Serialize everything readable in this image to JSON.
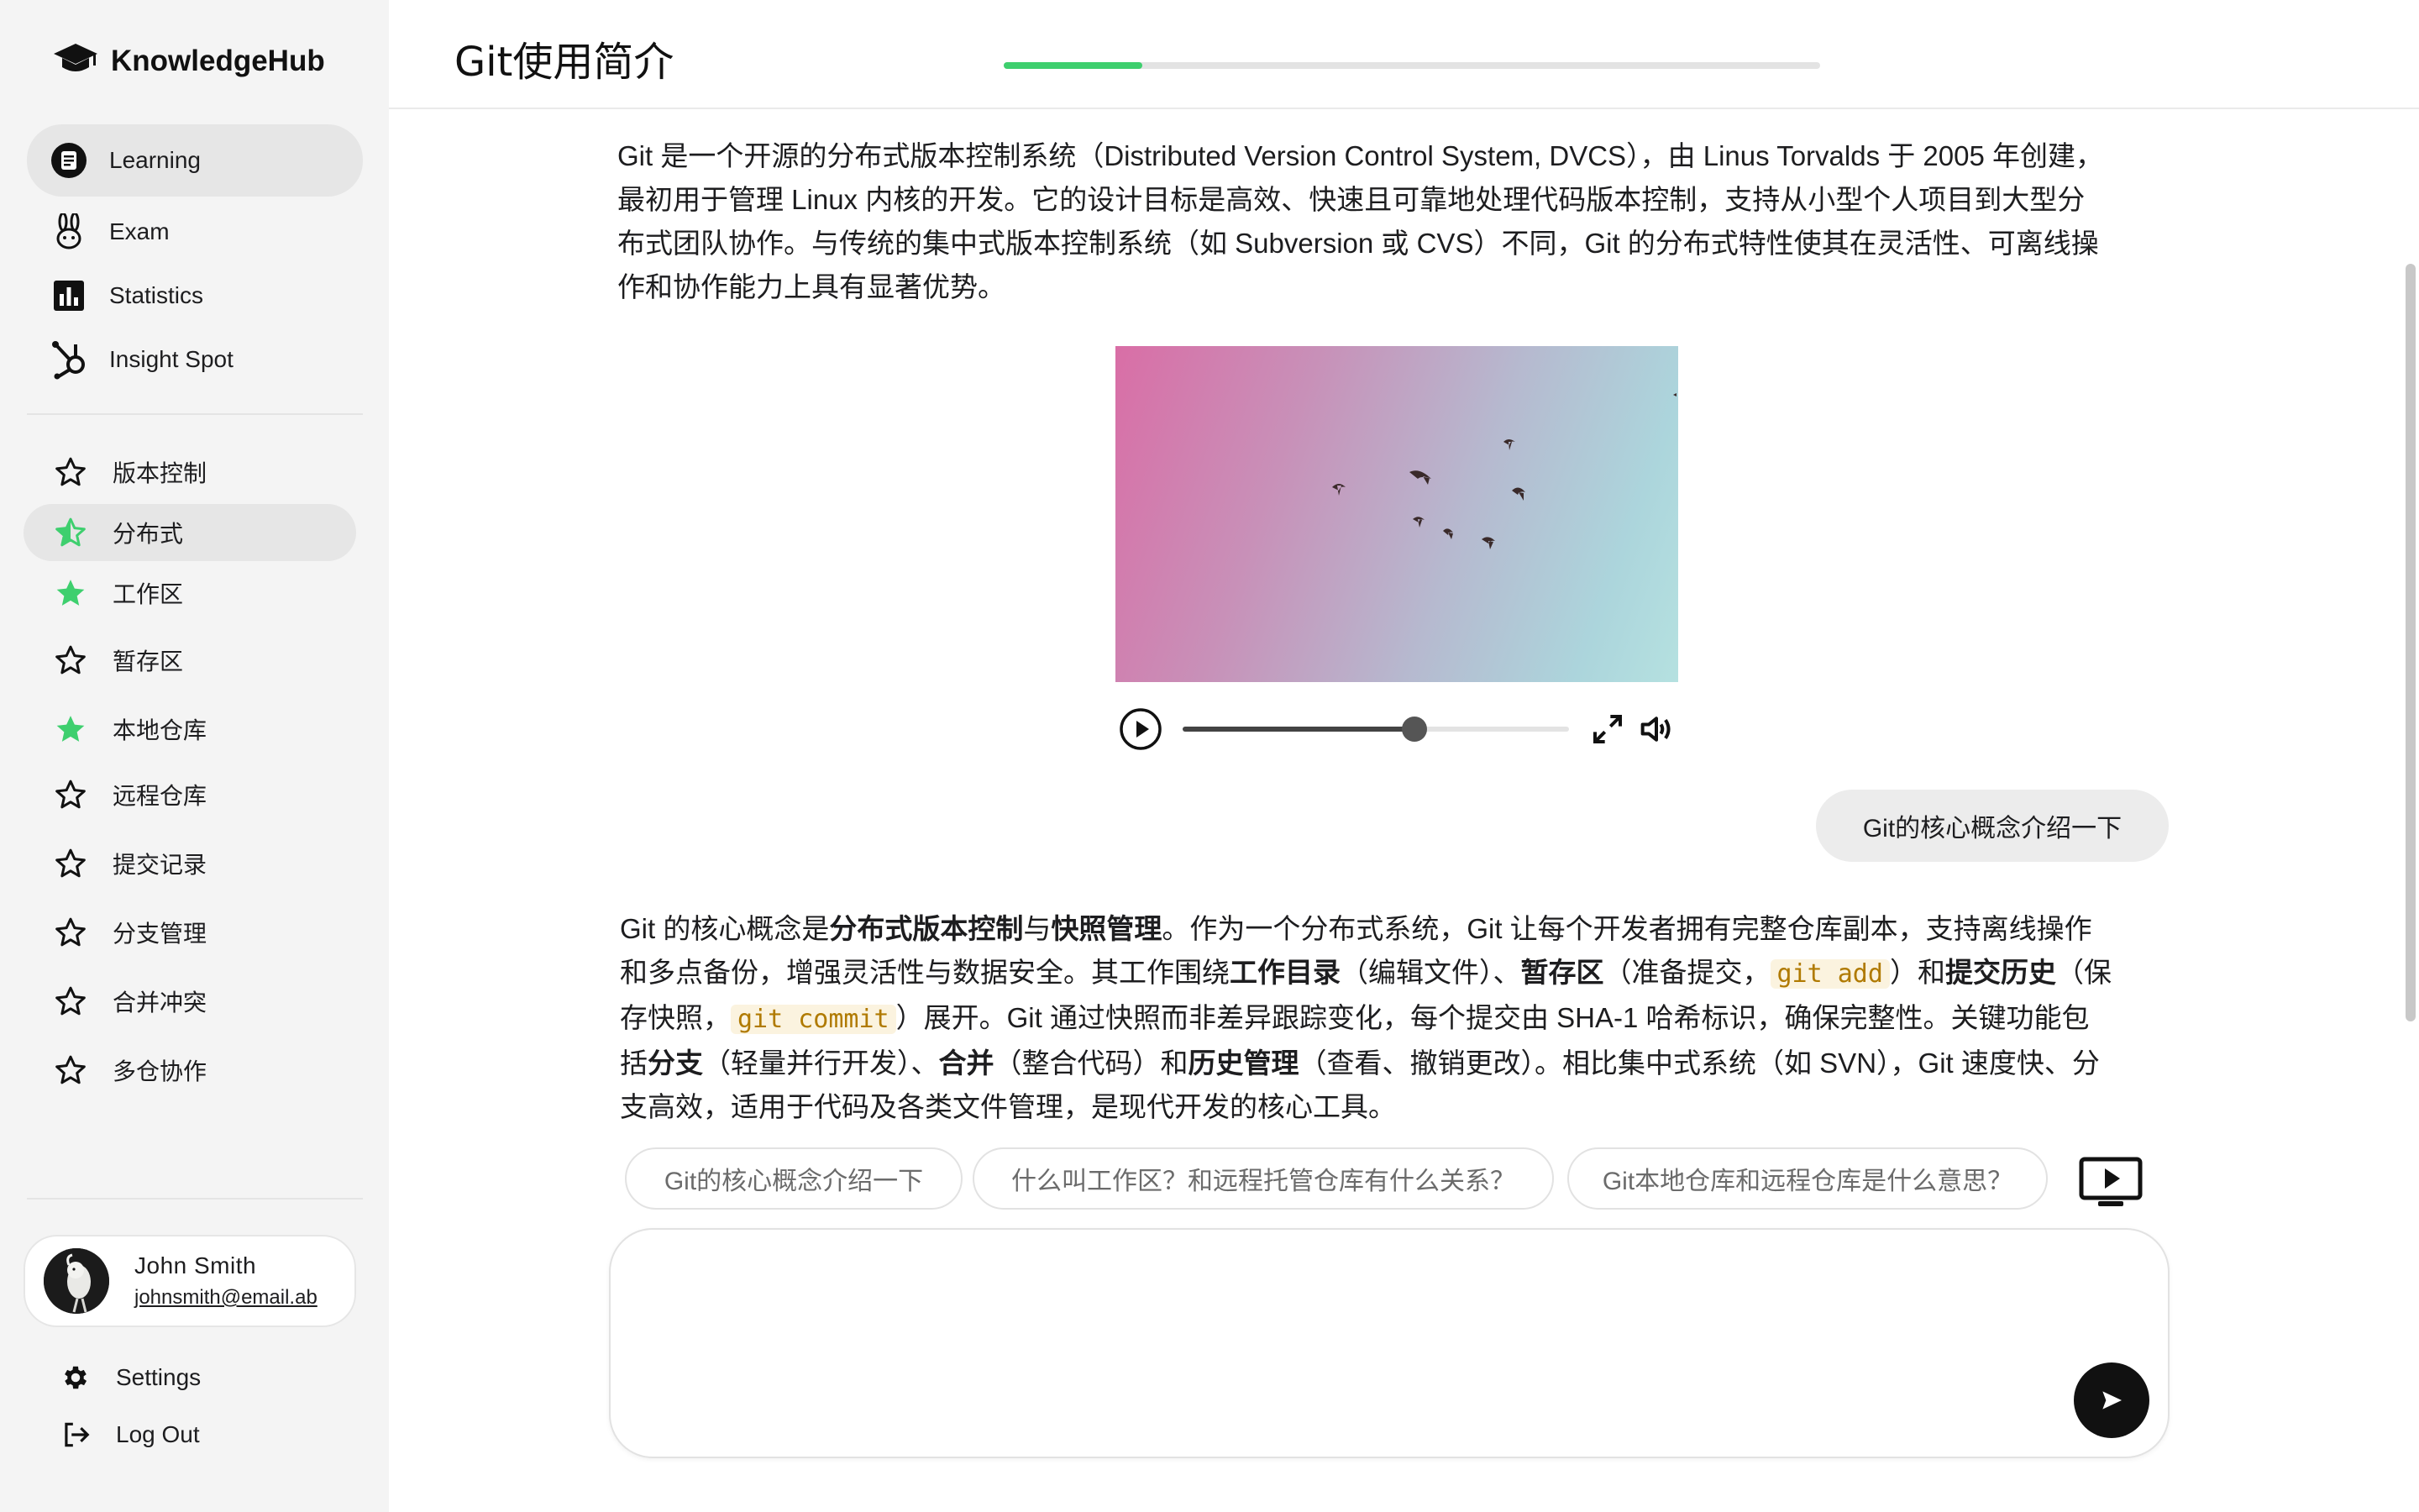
{
  "app": {
    "name": "KnowledgeHub"
  },
  "nav": {
    "items": [
      {
        "label": "Learning",
        "icon": "notebook-icon",
        "active": true
      },
      {
        "label": "Exam",
        "icon": "rabbit-icon",
        "active": false
      },
      {
        "label": "Statistics",
        "icon": "bar-chart-icon",
        "active": false
      },
      {
        "label": "Insight Spot",
        "icon": "hub-icon",
        "active": false
      }
    ]
  },
  "topics": [
    {
      "label": "版本控制",
      "state": "empty"
    },
    {
      "label": "分布式",
      "state": "half",
      "active": true
    },
    {
      "label": "工作区",
      "state": "full"
    },
    {
      "label": "暂存区",
      "state": "empty"
    },
    {
      "label": "本地仓库",
      "state": "full"
    },
    {
      "label": "远程仓库",
      "state": "empty"
    },
    {
      "label": "提交记录",
      "state": "empty"
    },
    {
      "label": "分支管理",
      "state": "empty"
    },
    {
      "label": "合并冲突",
      "state": "empty"
    },
    {
      "label": "多仓协作",
      "state": "empty"
    }
  ],
  "user": {
    "name": "John Smith",
    "email": "johnsmith@email.ab"
  },
  "footer": {
    "settings": "Settings",
    "logout": "Log Out"
  },
  "header": {
    "title": "Git使用简介",
    "progress": 0.17
  },
  "content": {
    "intro": "Git 是一个开源的分布式版本控制系统（Distributed Version Control System, DVCS），由 Linus Torvalds 于 2005 年创建，最初用于管理 Linux 内核的开发。它的设计目标是高效、快速且可靠地处理代码版本控制，支持从小型个人项目到大型分布式团队协作。与传统的集中式版本控制系统（如 Subversion 或 CVS）不同，Git 的分布式特性使其在灵活性、可离线操作和协作能力上具有显著优势。",
    "video": {
      "seek_progress": 0.6
    },
    "user_question": "Git的核心概念介绍一下",
    "answer": {
      "p1": "Git 的核心概念是",
      "b1": "分布式版本控制",
      "p2": "与",
      "b2": "快照管理",
      "p3": "。作为一个分布式系统，Git 让每个开发者拥有完整仓库副本，支持离线操作和多点备份，增强灵活性与数据安全。其工作围绕",
      "b3": "工作目录",
      "p4": "（编辑文件）、",
      "b4": "暂存区",
      "p5": "（准备提交，",
      "c1": "git add",
      "p6": "）和",
      "b5": "提交历史",
      "p7": "（保存快照，",
      "c2": "git commit",
      "p8": "）展开。Git 通过快照而非差异跟踪变化，每个提交由 SHA-1 哈希标识，确保完整性。关键功能包括",
      "b6": "分支",
      "p9": "（轻量并行开发）、",
      "b7": "合并",
      "p10": "（整合代码）和",
      "b8": "历史管理",
      "p11": "（查看、撤销更改）。相比集中式系统（如 SVN），Git 速度快、分支高效，适用于代码及各类文件管理，是现代开发的核心工具。"
    },
    "suggestions": [
      "Git的核心概念介绍一下",
      "什么叫工作区？和远程托管仓库有什么关系？",
      "Git本地仓库和远程仓库是什么意思？"
    ]
  },
  "composer": {
    "placeholder": ""
  },
  "colors": {
    "accent": "#3ecf6e",
    "code": "#b07a00",
    "active_bg": "#e6e6e6"
  }
}
